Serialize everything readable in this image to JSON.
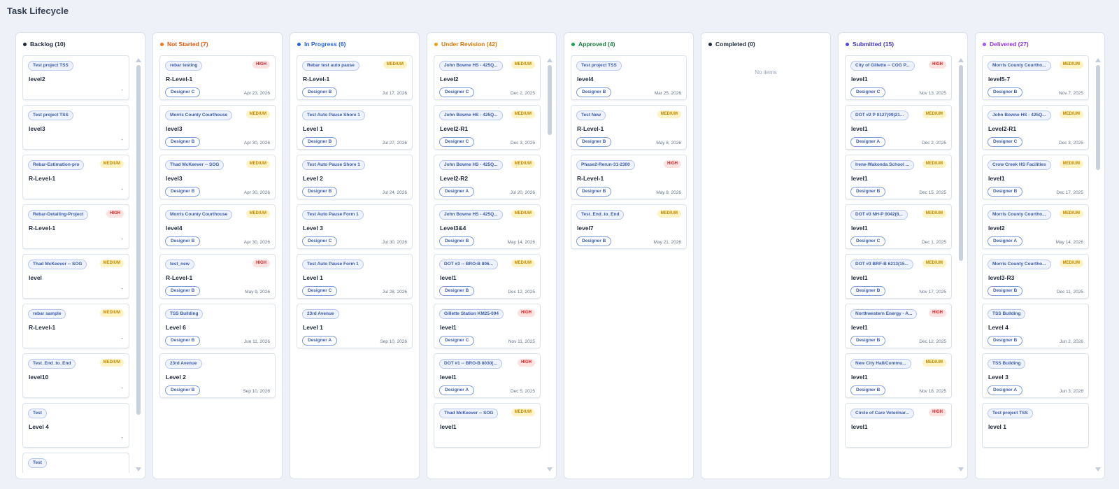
{
  "page": {
    "title": "Task Lifecycle"
  },
  "empty_text": "No items",
  "columns": [
    {
      "label": "Backlog (10)",
      "color": "#1e293b",
      "dot": "#1e293b",
      "scroll": true,
      "cards": [
        {
          "project": "Test project TSS",
          "priority": "",
          "task": "level2",
          "designer": "",
          "date": "-"
        },
        {
          "project": "Test project TSS",
          "priority": "",
          "task": "level3",
          "designer": "",
          "date": "-"
        },
        {
          "project": "Rebar-Estimation-pro",
          "priority": "MEDIUM",
          "task": "R-Level-1",
          "designer": "",
          "date": "-"
        },
        {
          "project": "Rebar-Detailing-Project",
          "priority": "HIGH",
          "task": "R-Level-1",
          "designer": "",
          "date": "-"
        },
        {
          "project": "Thad McKeever -- SOG",
          "priority": "MEDIUM",
          "task": "level",
          "designer": "",
          "date": "-"
        },
        {
          "project": "rebar sample",
          "priority": "MEDIUM",
          "task": "R-Level-1",
          "designer": "",
          "date": "-"
        },
        {
          "project": "Test_End_to_End",
          "priority": "MEDIUM",
          "task": "level10",
          "designer": "",
          "date": "-"
        },
        {
          "project": "Test",
          "priority": "",
          "task": "Level 4",
          "designer": "",
          "date": "-"
        },
        {
          "project": "Test",
          "priority": "",
          "task": "",
          "designer": "",
          "date": ""
        }
      ]
    },
    {
      "label": "Not Started (7)",
      "color": "#ea580c",
      "dot": "#f97316",
      "scroll": false,
      "cards": [
        {
          "project": "rebar testing",
          "priority": "HIGH",
          "task": "R-Level-1",
          "designer": "Designer C",
          "date": "Apr 23, 2026"
        },
        {
          "project": "Morris County Courthouse",
          "priority": "MEDIUM",
          "task": "level3",
          "designer": "Designer B",
          "date": "Apr 30, 2026"
        },
        {
          "project": "Thad McKeever -- SOG",
          "priority": "MEDIUM",
          "task": "level3",
          "designer": "Designer B",
          "date": "Apr 30, 2026"
        },
        {
          "project": "Morris County Courthouse",
          "priority": "MEDIUM",
          "task": "level4",
          "designer": "Designer B",
          "date": "Apr 30, 2026"
        },
        {
          "project": "test_new",
          "priority": "HIGH",
          "task": "R-Level-1",
          "designer": "Designer B",
          "date": "May 9, 2026"
        },
        {
          "project": "TSS Building",
          "priority": "",
          "task": "Level 6",
          "designer": "Designer B",
          "date": "Jun 11, 2026"
        },
        {
          "project": "23rd Avenue",
          "priority": "",
          "task": "Level 2",
          "designer": "Designer B",
          "date": "Sep 10, 2026"
        }
      ]
    },
    {
      "label": "In Progress (6)",
      "color": "#2563eb",
      "dot": "#2563eb",
      "scroll": false,
      "cards": [
        {
          "project": "Rebar test auto pause",
          "priority": "MEDIUM",
          "task": "R-Level-1",
          "designer": "Designer B",
          "date": "Jul 17, 2026"
        },
        {
          "project": "Test Auto Pause Shore 1",
          "priority": "",
          "task": "Level 1",
          "designer": "Designer B",
          "date": "Jul 27, 2026"
        },
        {
          "project": "Test Auto Pause Shore 1",
          "priority": "",
          "task": "Level 2",
          "designer": "Designer B",
          "date": "Jul 24, 2026"
        },
        {
          "project": "Test Auto Pause Form 1",
          "priority": "",
          "task": "Level 3",
          "designer": "Designer C",
          "date": "Jul 30, 2026"
        },
        {
          "project": "Test Auto Pause Form 1",
          "priority": "",
          "task": "Level 1",
          "designer": "Designer C",
          "date": "Jul 28, 2026"
        },
        {
          "project": "23rd Avenue",
          "priority": "",
          "task": "Level 1",
          "designer": "Designer A",
          "date": "Sep 10, 2026"
        }
      ]
    },
    {
      "label": "Under Revision (42)",
      "color": "#d97706",
      "dot": "#f59e0b",
      "scroll": true,
      "cards": [
        {
          "project": "John Bowne HS - 425Q...",
          "priority": "MEDIUM",
          "task": "Level2",
          "designer": "Designer C",
          "date": "Dec 2, 2025"
        },
        {
          "project": "John Bowne HS - 425Q...",
          "priority": "MEDIUM",
          "task": "Level2-R1",
          "designer": "Designer C",
          "date": "Dec 3, 2025"
        },
        {
          "project": "John Bowne HS - 425Q...",
          "priority": "MEDIUM",
          "task": "Level2-R2",
          "designer": "Designer A",
          "date": "Jul 20, 2026"
        },
        {
          "project": "John Bowne HS - 425Q...",
          "priority": "MEDIUM",
          "task": "Level3&4",
          "designer": "Designer B",
          "date": "May 14, 2026"
        },
        {
          "project": "DOT #3 -- BRO-B 806...",
          "priority": "MEDIUM",
          "task": "level1",
          "designer": "Designer B",
          "date": "Dec 12, 2025"
        },
        {
          "project": "Gillette Station KM25-004",
          "priority": "HIGH",
          "task": "level1",
          "designer": "Designer C",
          "date": "Nov 11, 2025"
        },
        {
          "project": "DOT #1 -- BRO-B 8030(...",
          "priority": "HIGH",
          "task": "level1",
          "designer": "Designer A",
          "date": "Dec 5, 2025"
        },
        {
          "project": "Thad McKeever -- SOG",
          "priority": "MEDIUM",
          "task": "level1",
          "designer": "",
          "date": ""
        }
      ]
    },
    {
      "label": "Approved (4)",
      "color": "#15803d",
      "dot": "#16a34a",
      "scroll": false,
      "cards": [
        {
          "project": "Test project TSS",
          "priority": "",
          "task": "level4",
          "designer": "Designer B",
          "date": "Mar 25, 2026"
        },
        {
          "project": "Test New",
          "priority": "MEDIUM",
          "task": "R-Level-1",
          "designer": "Designer B",
          "date": "May 8, 2026"
        },
        {
          "project": "Phase2-Rerun-31-2300",
          "priority": "HIGH",
          "task": "R-Level-1",
          "designer": "Designer B",
          "date": "May 8, 2026"
        },
        {
          "project": "Test_End_to_End",
          "priority": "MEDIUM",
          "task": "level7",
          "designer": "Designer B",
          "date": "May 21, 2026"
        }
      ]
    },
    {
      "label": "Completed (0)",
      "color": "#1e293b",
      "dot": "#1e293b",
      "scroll": false,
      "cards": []
    },
    {
      "label": "Submitted (15)",
      "color": "#4338ca",
      "dot": "#4f46e5",
      "scroll": true,
      "cards": [
        {
          "project": "City of Gillette -- COG P...",
          "priority": "HIGH",
          "task": "level1",
          "designer": "Designer C",
          "date": "Nov 13, 2025"
        },
        {
          "project": "DOT #2 P 0127(09)21...",
          "priority": "MEDIUM",
          "task": "level1",
          "designer": "Designer A",
          "date": "Dec 2, 2025"
        },
        {
          "project": "Irene-Wakonda School ...",
          "priority": "MEDIUM",
          "task": "level1",
          "designer": "Designer B",
          "date": "Dec 15, 2025"
        },
        {
          "project": "DOT #3 NH-P 0042(8...",
          "priority": "MEDIUM",
          "task": "level1",
          "designer": "Designer C",
          "date": "Dec 1, 2025"
        },
        {
          "project": "DOT #3 BRF-B 6213(15...",
          "priority": "MEDIUM",
          "task": "level1",
          "designer": "Designer B",
          "date": "Nov 17, 2025"
        },
        {
          "project": "Northwestern Energy - A...",
          "priority": "HIGH",
          "task": "level1",
          "designer": "Designer B",
          "date": "Dec 12, 2025"
        },
        {
          "project": "New City Hall/Commu...",
          "priority": "MEDIUM",
          "task": "level1",
          "designer": "Designer B",
          "date": "Nov 18, 2025"
        },
        {
          "project": "Circle of Care Veterinar...",
          "priority": "HIGH",
          "task": "level1",
          "designer": "",
          "date": ""
        }
      ]
    },
    {
      "label": "Delivered (27)",
      "color": "#9333ea",
      "dot": "#a855f7",
      "scroll": true,
      "cards": [
        {
          "project": "Morris County Courtho...",
          "priority": "MEDIUM",
          "task": "level5-7",
          "designer": "Designer B",
          "date": "Nov 7, 2025"
        },
        {
          "project": "John Bowne HS - 425Q...",
          "priority": "MEDIUM",
          "task": "Level2-R1",
          "designer": "Designer C",
          "date": "Dec 3, 2025"
        },
        {
          "project": "Crow Creek HS Facilities",
          "priority": "MEDIUM",
          "task": "level1",
          "designer": "Designer B",
          "date": "Dec 17, 2025"
        },
        {
          "project": "Morris County Courtho...",
          "priority": "MEDIUM",
          "task": "level2",
          "designer": "Designer A",
          "date": "May 14, 2026"
        },
        {
          "project": "Morris County Courtho...",
          "priority": "MEDIUM",
          "task": "level3-R3",
          "designer": "Designer B",
          "date": "Dec 11, 2025"
        },
        {
          "project": "TSS Building",
          "priority": "",
          "task": "Level 4",
          "designer": "Designer B",
          "date": "Jun 2, 2026"
        },
        {
          "project": "TSS Building",
          "priority": "",
          "task": "Level 3",
          "designer": "Designer A",
          "date": "Jun 3, 2026"
        },
        {
          "project": "Test project TSS",
          "priority": "",
          "task": "level 1",
          "designer": "",
          "date": ""
        }
      ]
    }
  ]
}
